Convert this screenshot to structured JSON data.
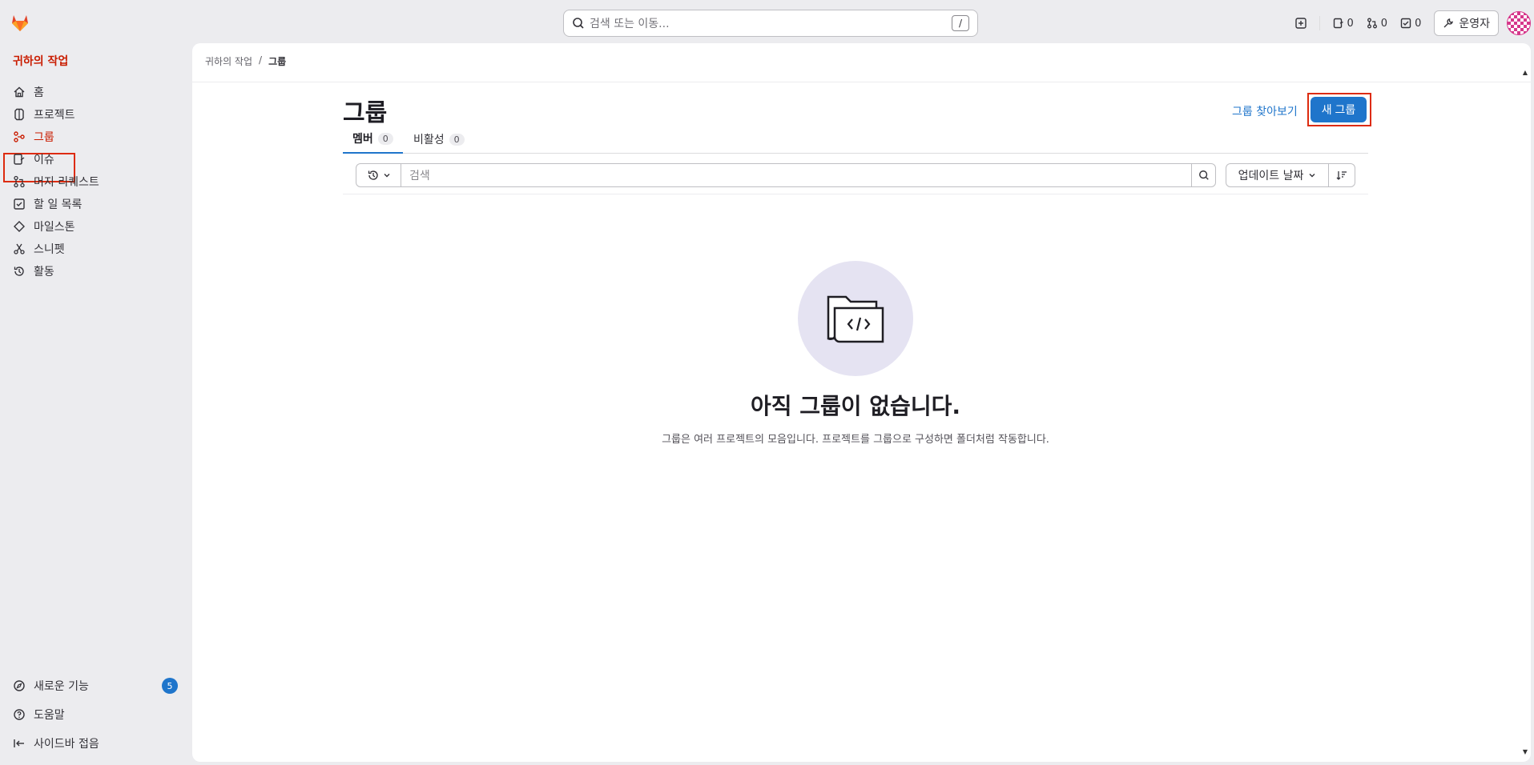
{
  "topbar": {
    "search_placeholder": "검색 또는 이동...",
    "search_shortcut": "/",
    "issues_count": "0",
    "merge_requests_count": "0",
    "todos_count": "0",
    "admin_label": "운영자"
  },
  "sidebar": {
    "title": "귀하의 작업",
    "items": [
      {
        "label": "홈",
        "icon": "home-icon"
      },
      {
        "label": "프로젝트",
        "icon": "project-icon"
      },
      {
        "label": "그룹",
        "icon": "group-icon"
      },
      {
        "label": "이슈",
        "icon": "issues-icon"
      },
      {
        "label": "머지 리퀘스트",
        "icon": "merge-request-icon"
      },
      {
        "label": "할 일 목록",
        "icon": "todo-icon"
      },
      {
        "label": "마일스톤",
        "icon": "milestone-icon"
      },
      {
        "label": "스니펫",
        "icon": "snippet-icon"
      },
      {
        "label": "활동",
        "icon": "history-icon"
      }
    ],
    "whats_new_label": "새로운 기능",
    "whats_new_count": "5",
    "help_label": "도움말",
    "collapse_label": "사이드바 접음"
  },
  "breadcrumb": {
    "parent": "귀하의 작업",
    "separator": "/",
    "current": "그룹"
  },
  "page": {
    "title": "그룹",
    "explore_link": "그룹 찾아보기",
    "new_group_button": "새 그룹"
  },
  "tabs": [
    {
      "label": "멤버",
      "count": "0"
    },
    {
      "label": "비활성",
      "count": "0"
    }
  ],
  "filter": {
    "search_placeholder": "검색",
    "sort_label": "업데이트 날짜"
  },
  "empty_state": {
    "title": "아직 그룹이 없습니다.",
    "description": "그룹은 여러 프로젝트의 모음입니다. 프로젝트를 그룹으로 구성하면 폴더처럼 작동합니다."
  },
  "colors": {
    "accent": "#1f75cb",
    "brand_orange": "#c91c00",
    "highlight": "#dd2b0e"
  }
}
